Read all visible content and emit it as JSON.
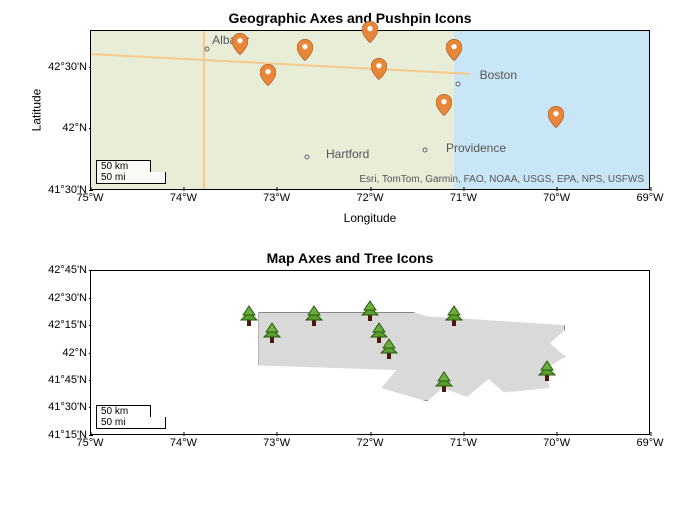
{
  "chart_data": [
    {
      "type": "scatter",
      "title": "Geographic Axes and Pushpin Icons",
      "xlabel": "Longitude",
      "ylabel": "Latitude",
      "xlim": [
        -75,
        -69
      ],
      "ylim": [
        41.5,
        42.8
      ],
      "x_ticks": [
        "75°W",
        "74°W",
        "73°W",
        "72°W",
        "71°W",
        "70°W",
        "69°W"
      ],
      "y_ticks": [
        "41°30'N",
        "42°N",
        "42°30'N"
      ],
      "series": [
        {
          "name": "Pushpins",
          "points": [
            {
              "lon": -73.4,
              "lat": 42.6
            },
            {
              "lon": -73.1,
              "lat": 42.35
            },
            {
              "lon": -72.7,
              "lat": 42.55
            },
            {
              "lon": -72.0,
              "lat": 42.7
            },
            {
              "lon": -71.9,
              "lat": 42.4
            },
            {
              "lon": -71.1,
              "lat": 42.55
            },
            {
              "lon": -71.2,
              "lat": 42.1
            },
            {
              "lon": -70.0,
              "lat": 42.0
            }
          ]
        }
      ],
      "cities": [
        {
          "name": "Albany",
          "lon": -73.75,
          "lat": 42.65
        },
        {
          "name": "Boston",
          "lon": -71.05,
          "lat": 42.36
        },
        {
          "name": "Hartford",
          "lon": -72.68,
          "lat": 41.76
        },
        {
          "name": "Providence",
          "lon": -71.41,
          "lat": 41.82
        }
      ],
      "attribution": "Esri, TomTom, Garmin, FAO, NOAA, USGS, EPA, NPS, USFWS",
      "scale": [
        "50 km",
        "50 mi"
      ]
    },
    {
      "type": "scatter",
      "title": "Map Axes and Tree Icons",
      "xlabel": "",
      "ylabel": "",
      "xlim": [
        -75,
        -69
      ],
      "ylim": [
        41.25,
        42.75
      ],
      "x_ticks": [
        "75°W",
        "74°W",
        "73°W",
        "72°W",
        "71°W",
        "70°W",
        "69°W"
      ],
      "y_ticks": [
        "41°15'N",
        "41°30'N",
        "41°45'N",
        "42°N",
        "42°15'N",
        "42°30'N",
        "42°45'N"
      ],
      "series": [
        {
          "name": "Trees",
          "points": [
            {
              "lon": -73.3,
              "lat": 42.35
            },
            {
              "lon": -73.05,
              "lat": 42.2
            },
            {
              "lon": -72.6,
              "lat": 42.35
            },
            {
              "lon": -72.0,
              "lat": 42.4
            },
            {
              "lon": -71.9,
              "lat": 42.2
            },
            {
              "lon": -71.8,
              "lat": 42.05
            },
            {
              "lon": -71.1,
              "lat": 42.35
            },
            {
              "lon": -71.2,
              "lat": 41.75
            },
            {
              "lon": -70.1,
              "lat": 41.85
            }
          ]
        }
      ],
      "scale": [
        "50 km",
        "50 mi"
      ]
    }
  ]
}
